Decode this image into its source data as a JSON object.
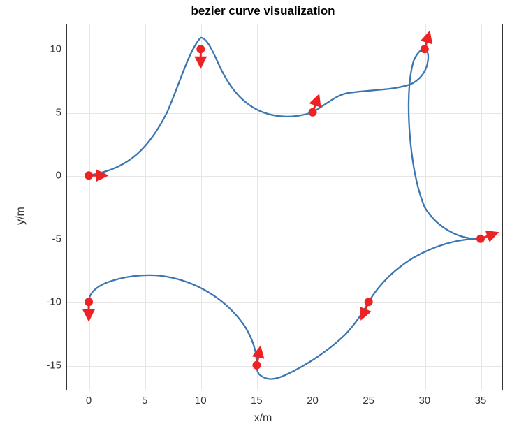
{
  "chart_data": {
    "type": "line",
    "title": "bezier curve visualization",
    "xlabel": "x/m",
    "ylabel": "y/m",
    "xlim": [
      -2,
      37
    ],
    "ylim": [
      -17,
      12
    ],
    "xticks": [
      0,
      5,
      10,
      15,
      20,
      25,
      30,
      35
    ],
    "yticks": [
      -15,
      -10,
      -5,
      0,
      5,
      10
    ],
    "control_points": [
      {
        "x": 0,
        "y": 0,
        "tx": 1.5,
        "ty": 0
      },
      {
        "x": 10,
        "y": 10,
        "tx": 0,
        "ty": -1.5
      },
      {
        "x": 20,
        "y": 5,
        "tx": 0.5,
        "ty": 1.4
      },
      {
        "x": 30,
        "y": 10,
        "tx": 0.4,
        "ty": 1.4
      },
      {
        "x": 35,
        "y": -5,
        "tx": 1.4,
        "ty": 0.5
      },
      {
        "x": 25,
        "y": -10,
        "tx": -0.6,
        "ty": -1.4
      },
      {
        "x": 15,
        "y": -15,
        "tx": 0.3,
        "ty": 1.5
      },
      {
        "x": 0,
        "y": -10,
        "tx": 0,
        "ty": -1.5
      }
    ],
    "curve_segments": [
      "M0,0 C3,0.5 5,1.5 7,5 C8,7 9,10 10,10.9 C10.5,10.9 11,10 11.5,9 C12.5,7 14,5 17,4.7 C18,4.6 19,4.7 20,5",
      "M20,5 C21,5.5 22,6.3 23,6.5 C25,6.8 27,6.7 28.7,7.2 C29.5,7.5 30.2,8.2 30.3,9.1 C30.4,9.6 30.2,10 30,10",
      "M30,10 C29.6,10 29.2,9.5 29,9 C28.5,7.5 28.5,5 28.7,3 C28.9,1 29.3,-1 30,-2.5 C31,-4 33,-5.1 35,-5",
      "M35,-5 C35.3,-5 35.7,-4.7 36,-4.5 M35,-5 C33,-5 31,-5.5 29,-6.5 C27.5,-7.3 26,-8.5 25,-10",
      "M25,-10 C24.5,-10.8 24,-11.5 23,-12.5 C21.5,-13.8 19.5,-15 17.5,-15.8 C16.5,-16.2 15.8,-16.2 15.2,-15.7 C15,-15.4 15,-15.2 15,-15",
      "M15,-15 C15,-14.5 15,-13.5 14,-12 C12.5,-10 10,-8.5 7,-8 C5,-7.7 3,-8 1.5,-8.5 C0.5,-8.9 0,-9.4 0,-10"
    ],
    "colors": {
      "curve": "#3C76B0",
      "marker": "#ED2224",
      "grid": "#e6e6e6"
    }
  }
}
